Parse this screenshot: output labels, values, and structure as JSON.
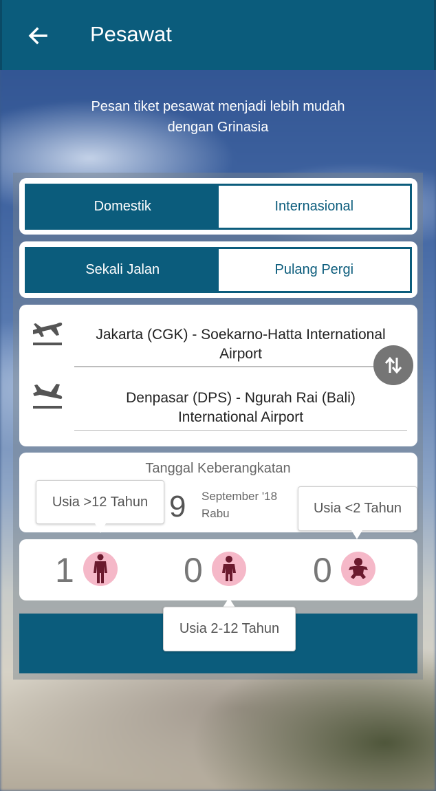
{
  "header": {
    "title": "Pesawat",
    "back_icon": "arrow-left-icon"
  },
  "tagline": {
    "line1": "Pesan tiket pesawat menjadi lebih mudah",
    "line2": "dengan Grinasia"
  },
  "flight_scope": {
    "options": [
      "Domestik",
      "Internasional"
    ],
    "selected": "Domestik"
  },
  "trip_type": {
    "options": [
      "Sekali Jalan",
      "Pulang Pergi"
    ],
    "selected": "Sekali Jalan"
  },
  "route": {
    "origin": {
      "line1": "Jakarta (CGK) - Soekarno-Hatta International",
      "line2": "Airport",
      "icon": "plane-departure-icon"
    },
    "destination": {
      "line1": "Denpasar (DPS) - Ngurah Rai (Bali)",
      "line2": "International Airport",
      "icon": "plane-arrival-icon"
    },
    "swap_icon": "swap-vertical-icon"
  },
  "departure": {
    "label": "Tanggal Keberangkatan",
    "day": "9",
    "month": "September '18",
    "weekday": "Rabu"
  },
  "passengers": {
    "adult": {
      "count": "1",
      "tooltip": "Usia >12 Tahun",
      "icon": "adult-icon"
    },
    "child": {
      "count": "0",
      "tooltip": "Usia 2-12 Tahun",
      "icon": "child-icon"
    },
    "infant": {
      "count": "0",
      "tooltip": "Usia <2 Tahun",
      "icon": "infant-icon"
    }
  },
  "colors": {
    "primary": "#0b5c7c",
    "accent_pink": "#f5b8c8",
    "icon_dark": "#6b1a2e"
  }
}
